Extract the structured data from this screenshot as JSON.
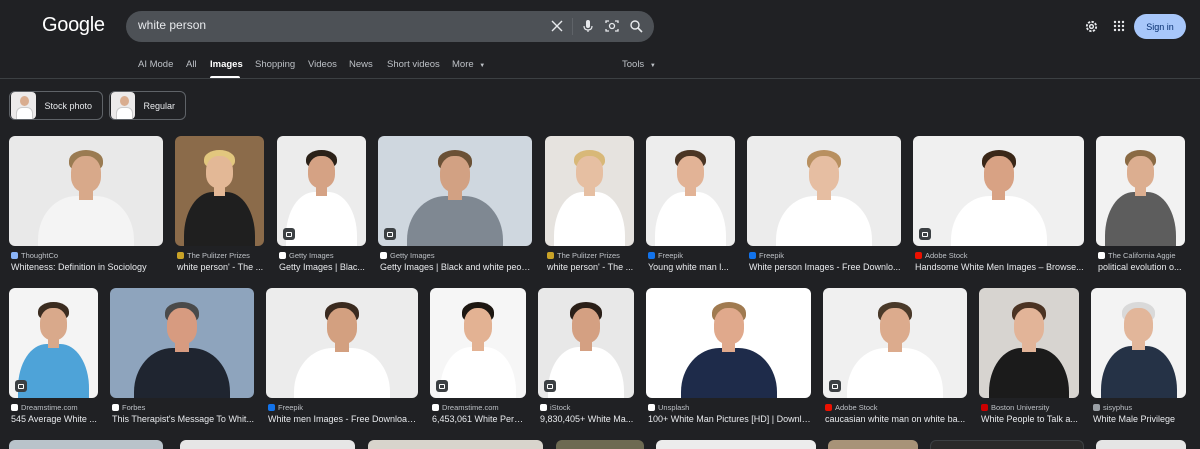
{
  "header": {
    "logo": "Google",
    "search_query": "white person",
    "sign_in_label": "Sign in"
  },
  "tabs": [
    {
      "label": "AI Mode"
    },
    {
      "label": "All"
    },
    {
      "label": "Images",
      "active": true
    },
    {
      "label": "Shopping"
    },
    {
      "label": "Videos"
    },
    {
      "label": "News"
    },
    {
      "label": "Short videos"
    },
    {
      "label": "More"
    }
  ],
  "tools_label": "Tools",
  "chips": [
    {
      "label": "Stock photo"
    },
    {
      "label": "Regular"
    }
  ],
  "results_row1": [
    {
      "source": "ThoughtCo",
      "title": "Whiteness: Definition in Sociology",
      "fav_color": "#8ab4f8"
    },
    {
      "source": "The Pulitzer Prizes",
      "title": "white person' - The ...",
      "fav_color": "#c9a227"
    },
    {
      "source": "Getty Images",
      "title": "Getty Images | Blac...",
      "fav_color": "#ffffff"
    },
    {
      "source": "Getty Images",
      "title": "Getty Images | Black and white peop...",
      "fav_color": "#ffffff"
    },
    {
      "source": "The Pulitzer Prizes",
      "title": "white person' - The ...",
      "fav_color": "#c9a227"
    },
    {
      "source": "Freepik",
      "title": "Young white man l...",
      "fav_color": "#1273eb"
    },
    {
      "source": "Freepik",
      "title": "White person Images - Free Downlo...",
      "fav_color": "#1273eb"
    },
    {
      "source": "Adobe Stock",
      "title": "Handsome White Men Images – Browse...",
      "fav_color": "#eb1000"
    },
    {
      "source": "The California Aggie",
      "title": "political evolution o...",
      "fav_color": "#ffffff"
    }
  ],
  "results_row2": [
    {
      "source": "Dreamstime.com",
      "title": "545 Average White ...",
      "fav_color": "#ffffff"
    },
    {
      "source": "Forbes",
      "title": "This Therapist's Message To Whit...",
      "fav_color": "#ffffff"
    },
    {
      "source": "Freepik",
      "title": "White men Images - Free Download...",
      "fav_color": "#1273eb"
    },
    {
      "source": "Dreamstime.com",
      "title": "6,453,061 White Pers...",
      "fav_color": "#ffffff"
    },
    {
      "source": "iStock",
      "title": "9,830,405+ White Ma...",
      "fav_color": "#ffffff"
    },
    {
      "source": "Unsplash",
      "title": "100+ White Man Pictures [HD] | Downlo...",
      "fav_color": "#ffffff"
    },
    {
      "source": "Adobe Stock",
      "title": "caucasian white man on white ba...",
      "fav_color": "#eb1000"
    },
    {
      "source": "Boston University",
      "title": "White People to Talk a...",
      "fav_color": "#cc0000"
    },
    {
      "source": "sisyphus",
      "title": "White Male Privilege",
      "fav_color": "#9aa0a6"
    }
  ]
}
